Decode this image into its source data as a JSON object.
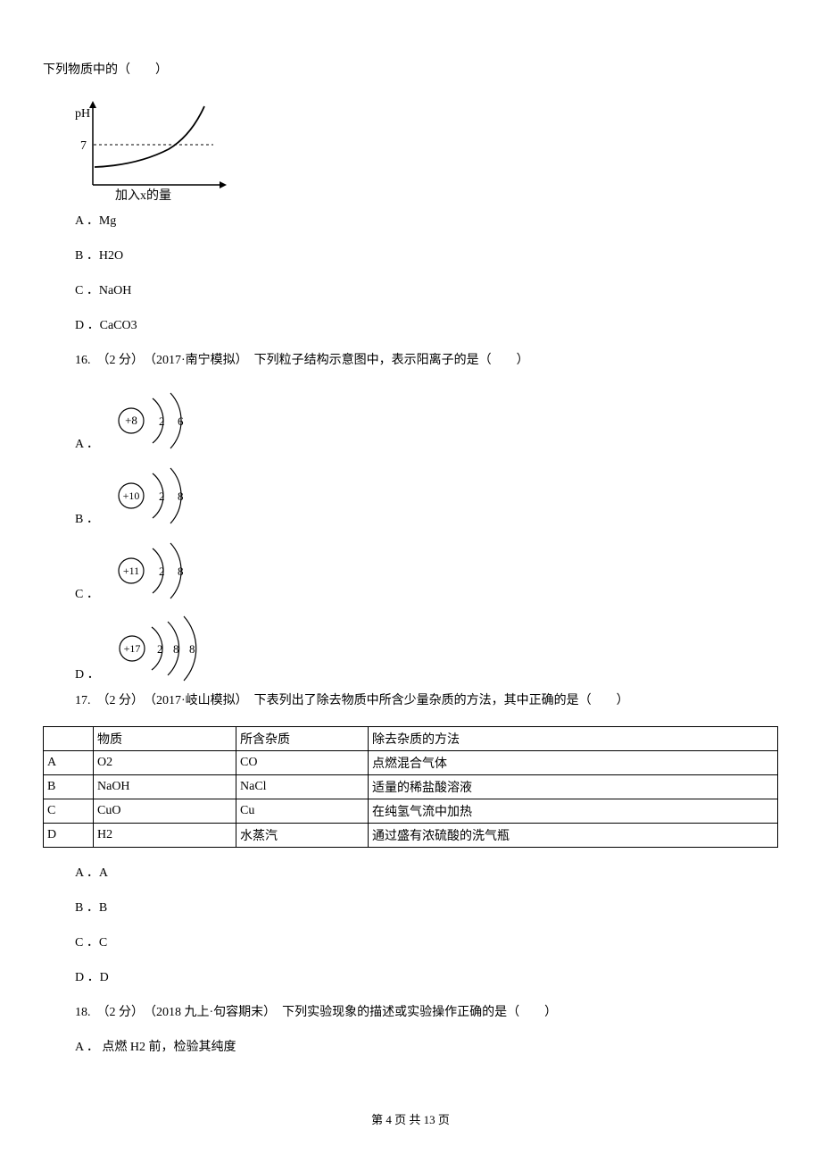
{
  "q15": {
    "lead_in": "下列物质中的（　　）",
    "graph": {
      "ylabel": "pH",
      "hline_label": "7",
      "xlabel": "加入x的量"
    },
    "options": [
      {
        "letter": "A ．",
        "text": "Mg"
      },
      {
        "letter": "B ．",
        "text": "H2O"
      },
      {
        "letter": "C ．",
        "text": "NaOH"
      },
      {
        "letter": "D ．",
        "text": "CaCO3"
      }
    ]
  },
  "q16": {
    "stem": "16.　（2 分）　（2017·南宁模拟）　下列粒子结构示意图中，表示阳离子的是（　　）",
    "options": [
      {
        "letter": "A ．",
        "nucleus": "+8",
        "shells": [
          "2",
          "6"
        ]
      },
      {
        "letter": "B ．",
        "nucleus": "+10",
        "shells": [
          "2",
          "8"
        ]
      },
      {
        "letter": "C ．",
        "nucleus": "+11",
        "shells": [
          "2",
          "8"
        ]
      },
      {
        "letter": "D ．",
        "nucleus": "+17",
        "shells": [
          "2",
          "8",
          "8"
        ]
      }
    ]
  },
  "q17": {
    "stem": "17.　（2 分）　（2017·岐山模拟）　下表列出了除去物质中所含少量杂质的方法，其中正确的是（　　）",
    "headers": [
      "",
      "物质",
      "所含杂质",
      "除去杂质的方法"
    ],
    "rows": [
      [
        "A",
        "O2",
        "CO",
        "点燃混合气体"
      ],
      [
        "B",
        "NaOH",
        "NaCl",
        "适量的稀盐酸溶液"
      ],
      [
        "C",
        "CuO",
        "Cu",
        "在纯氢气流中加热"
      ],
      [
        "D",
        "H2",
        "水蒸汽",
        "通过盛有浓硫酸的洗气瓶"
      ]
    ],
    "options": [
      {
        "letter": "A ．",
        "text": "A"
      },
      {
        "letter": "B ．",
        "text": "B"
      },
      {
        "letter": "C ．",
        "text": "C"
      },
      {
        "letter": "D ．",
        "text": "D"
      }
    ]
  },
  "q18": {
    "stem": "18.　（2 分）　（2018 九上·句容期末）　下列实验现象的描述或实验操作正确的是（　　）",
    "optA": {
      "letter": "A ．",
      "text": " 点燃 H2 前，检验其纯度"
    }
  },
  "footer": {
    "prefix": "第 ",
    "page": "4",
    "mid": " 页 共 ",
    "total": "13",
    "suffix": " 页"
  }
}
